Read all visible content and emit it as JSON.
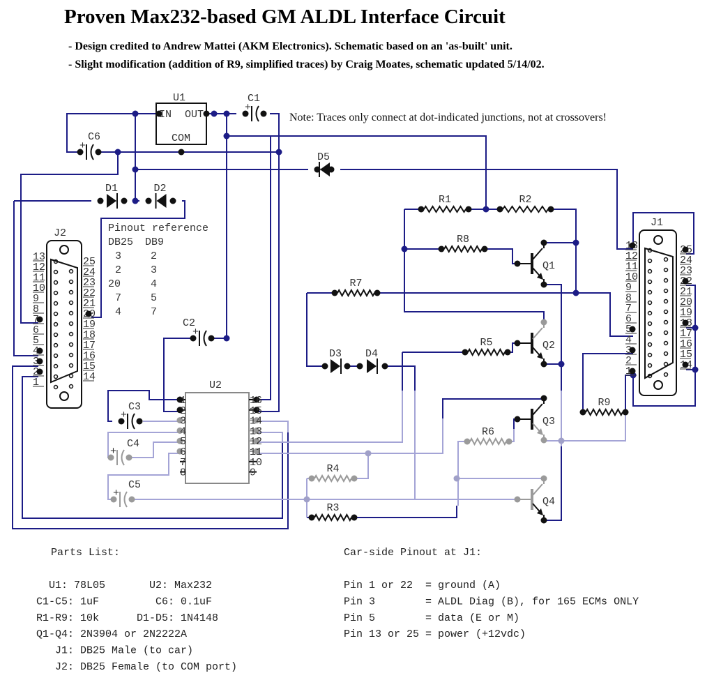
{
  "header": {
    "title": "Proven Max232-based GM ALDL Interface Circuit",
    "credit": "- Design credited to Andrew Mattei (AKM Electronics). Schematic based on an 'as-built' unit.",
    "modification": "- Slight modification (addition of R9, simplified traces) by Craig Moates, schematic updated 5/14/02."
  },
  "note": "Note: Traces only connect at dot-indicated junctions, not at crossovers!",
  "colors": {
    "trace_dark": "#1c1c86",
    "trace_light": "#a4a4d6",
    "component_dark": "#111111",
    "component_light": "#9a9a9a"
  },
  "components": {
    "U1": {
      "label": "U1",
      "pin_in": "IN",
      "pin_out": "OUT",
      "pin_com": "COM"
    },
    "U2": {
      "label": "U2",
      "pins_left": [
        "1",
        "2",
        "3",
        "4",
        "5",
        "6",
        "7",
        "8"
      ],
      "pins_right": [
        "16",
        "15",
        "14",
        "13",
        "12",
        "11",
        "10",
        "9"
      ]
    },
    "C1": "C1",
    "C2": "C2",
    "C3": "C3",
    "C4": "C4",
    "C5": "C5",
    "C6": "C6",
    "R1": "R1",
    "R2": "R2",
    "R3": "R3",
    "R4": "R4",
    "R5": "R5",
    "R6": "R6",
    "R7": "R7",
    "R8": "R8",
    "R9": "R9",
    "D1": "D1",
    "D2": "D2",
    "D3": "D3",
    "D4": "D4",
    "D5": "D5",
    "Q1": "Q1",
    "Q2": "Q2",
    "Q3": "Q3",
    "Q4": "Q4",
    "plus": "+"
  },
  "connectors": {
    "J1": {
      "label": "J1",
      "pins_left": [
        "13",
        "12",
        "11",
        "10",
        "9",
        "8",
        "7",
        "6",
        "5",
        "4",
        "3",
        "2",
        "1"
      ],
      "pins_right": [
        "25",
        "24",
        "23",
        "22",
        "21",
        "20",
        "19",
        "18",
        "17",
        "16",
        "15",
        "14"
      ]
    },
    "J2": {
      "label": "J2",
      "pins_left": [
        "13",
        "12",
        "11",
        "10",
        "9",
        "8",
        "7",
        "6",
        "5",
        "4",
        "3",
        "2",
        "1"
      ],
      "pins_right": [
        "25",
        "24",
        "23",
        "22",
        "21",
        "20",
        "19",
        "18",
        "17",
        "16",
        "15",
        "14"
      ]
    }
  },
  "pinout_reference": {
    "title": "Pinout reference",
    "headers": [
      "DB25",
      "DB9"
    ],
    "rows": [
      [
        "3",
        "2"
      ],
      [
        "2",
        "3"
      ],
      [
        "20",
        "4"
      ],
      [
        "7",
        "5"
      ],
      [
        "4",
        "7"
      ]
    ]
  },
  "parts_list": {
    "title": "Parts List:",
    "lines": [
      "  U1: 78L05       U2: Max232",
      "C1-C5: 1uF         C6: 0.1uF",
      "R1-R9: 10k      D1-D5: 1N4148",
      "Q1-Q4: 2N3904 or 2N2222A",
      "   J1: DB25 Male (to car)",
      "   J2: DB25 Female (to COM port)"
    ]
  },
  "car_pinout": {
    "title": "Car-side Pinout at J1:",
    "lines": [
      "Pin 1 or 22  = ground (A)",
      "Pin 3        = ALDL Diag (B), for 165 ECMs ONLY",
      "Pin 5        = data (E or M)",
      "Pin 13 or 25 = power (+12vdc)"
    ]
  }
}
